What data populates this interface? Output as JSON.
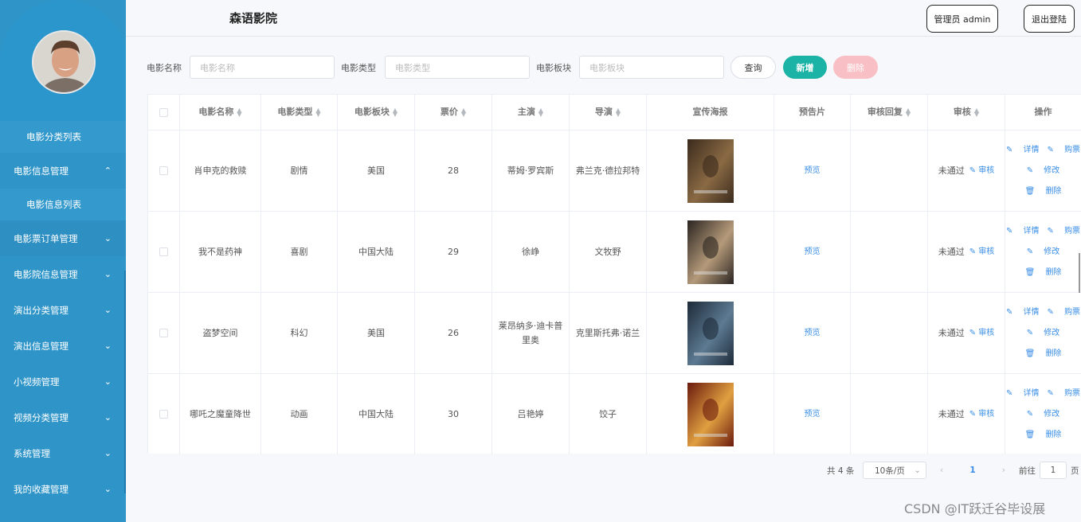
{
  "header": {
    "title": "森语影院",
    "admin_button": "管理员 admin",
    "logout_button": "退出登陆"
  },
  "sidebar": {
    "items": [
      {
        "label": "电影分类列表",
        "sub": true
      },
      {
        "label": "电影信息管理",
        "chevron": "up"
      },
      {
        "label": "电影信息列表",
        "sub": true
      },
      {
        "label": "电影票订单管理",
        "chevron": "down"
      },
      {
        "label": "电影院信息管理",
        "chevron": "down"
      },
      {
        "label": "演出分类管理",
        "chevron": "down"
      },
      {
        "label": "演出信息管理",
        "chevron": "down"
      },
      {
        "label": "小视频管理",
        "chevron": "down"
      },
      {
        "label": "视频分类管理",
        "chevron": "down"
      },
      {
        "label": "系统管理",
        "chevron": "down"
      },
      {
        "label": "我的收藏管理",
        "chevron": "down"
      }
    ]
  },
  "search": {
    "name_label": "电影名称",
    "name_placeholder": "电影名称",
    "type_label": "电影类型",
    "type_placeholder": "电影类型",
    "region_label": "电影板块",
    "region_placeholder": "电影板块",
    "query_button": "查询",
    "add_button": "新增",
    "delete_button": "删除"
  },
  "table": {
    "headers": [
      "电影名称",
      "电影类型",
      "电影板块",
      "票价",
      "主演",
      "导演",
      "宣传海报",
      "预告片",
      "审核回复",
      "审核",
      "操作"
    ],
    "rows": [
      {
        "name": "肖申克的救赎",
        "type": "剧情",
        "region": "美国",
        "price": "28",
        "actor": "蒂姆·罗宾斯",
        "director": "弗兰克·德拉邦特",
        "trailer": "预览",
        "reply": "",
        "status": "未通过",
        "audit": "审核",
        "poster_colors": [
          "#3a2a1c",
          "#8a6a44"
        ]
      },
      {
        "name": "我不是药神",
        "type": "喜剧",
        "region": "中国大陆",
        "price": "29",
        "actor": "徐峥",
        "director": "文牧野",
        "trailer": "预览",
        "reply": "",
        "status": "未通过",
        "audit": "审核",
        "poster_colors": [
          "#2a2420",
          "#b59a7a"
        ]
      },
      {
        "name": "盗梦空间",
        "type": "科幻",
        "region": "美国",
        "price": "26",
        "actor": "莱昂纳多·迪卡普里奥",
        "director": "克里斯托弗·诺兰",
        "trailer": "预览",
        "reply": "",
        "status": "未通过",
        "audit": "审核",
        "poster_colors": [
          "#1d2a38",
          "#5c7a92"
        ]
      },
      {
        "name": "哪吒之魔童降世",
        "type": "动画",
        "region": "中国大陆",
        "price": "30",
        "actor": "吕艳婷",
        "director": "饺子",
        "trailer": "预览",
        "reply": "",
        "status": "未通过",
        "audit": "审核",
        "poster_colors": [
          "#6a1a0e",
          "#e0a040"
        ]
      }
    ],
    "ops": {
      "detail": "详情",
      "buy": "购票",
      "edit": "修改",
      "delete": "删除"
    }
  },
  "pagination": {
    "total": "共 4 条",
    "page_size": "10条/页",
    "current": "1",
    "goto_label": "前往",
    "goto_value": "1",
    "page_suffix": "页"
  },
  "watermark": "CSDN @IT跃迁谷毕设展"
}
